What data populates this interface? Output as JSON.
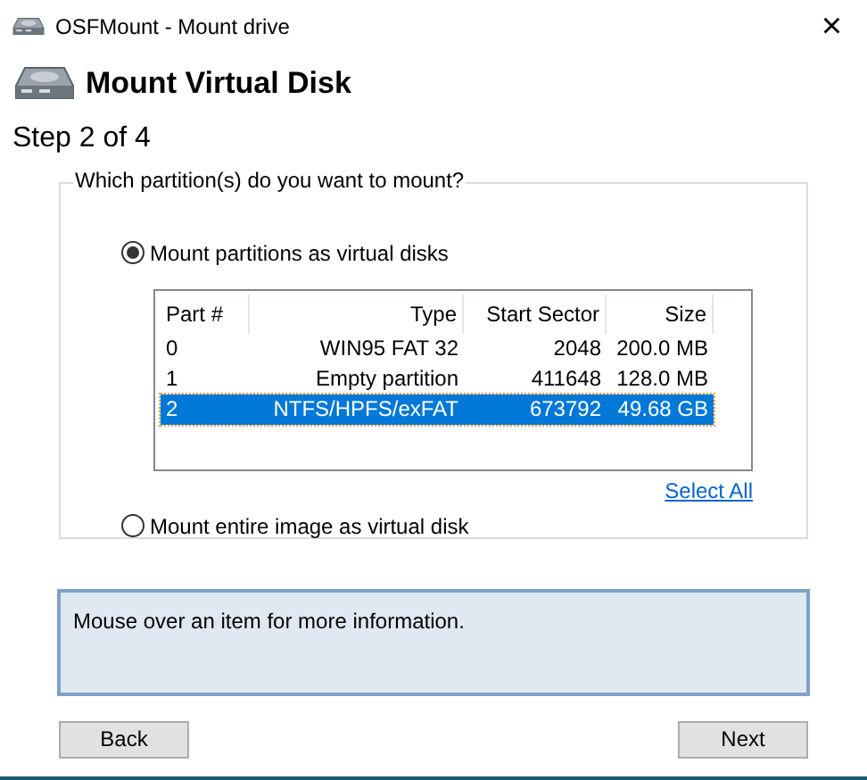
{
  "window": {
    "title": "OSFMount - Mount drive",
    "close": "×"
  },
  "header": {
    "title": "Mount Virtual Disk",
    "step": "Step 2 of 4"
  },
  "group": {
    "legend": "Which partition(s) do you want to mount?",
    "options": [
      {
        "label": "Mount partitions as virtual disks",
        "selected": true
      },
      {
        "label": "Mount entire image as virtual disk",
        "selected": false
      }
    ],
    "table": {
      "columns": [
        "Part #",
        "Type",
        "Start Sector",
        "Size"
      ],
      "rows": [
        {
          "cells": [
            "0",
            "WIN95 FAT 32",
            "2048",
            "200.0 MB"
          ],
          "selected": false
        },
        {
          "cells": [
            "1",
            "Empty partition",
            "411648",
            "128.0 MB"
          ],
          "selected": false
        },
        {
          "cells": [
            "2",
            "NTFS/HPFS/exFAT",
            "673792",
            "49.68 GB"
          ],
          "selected": true
        }
      ]
    },
    "select_all": "Select All"
  },
  "info": "Mouse over an item for more information.",
  "buttons": [
    "Back",
    "Next"
  ]
}
